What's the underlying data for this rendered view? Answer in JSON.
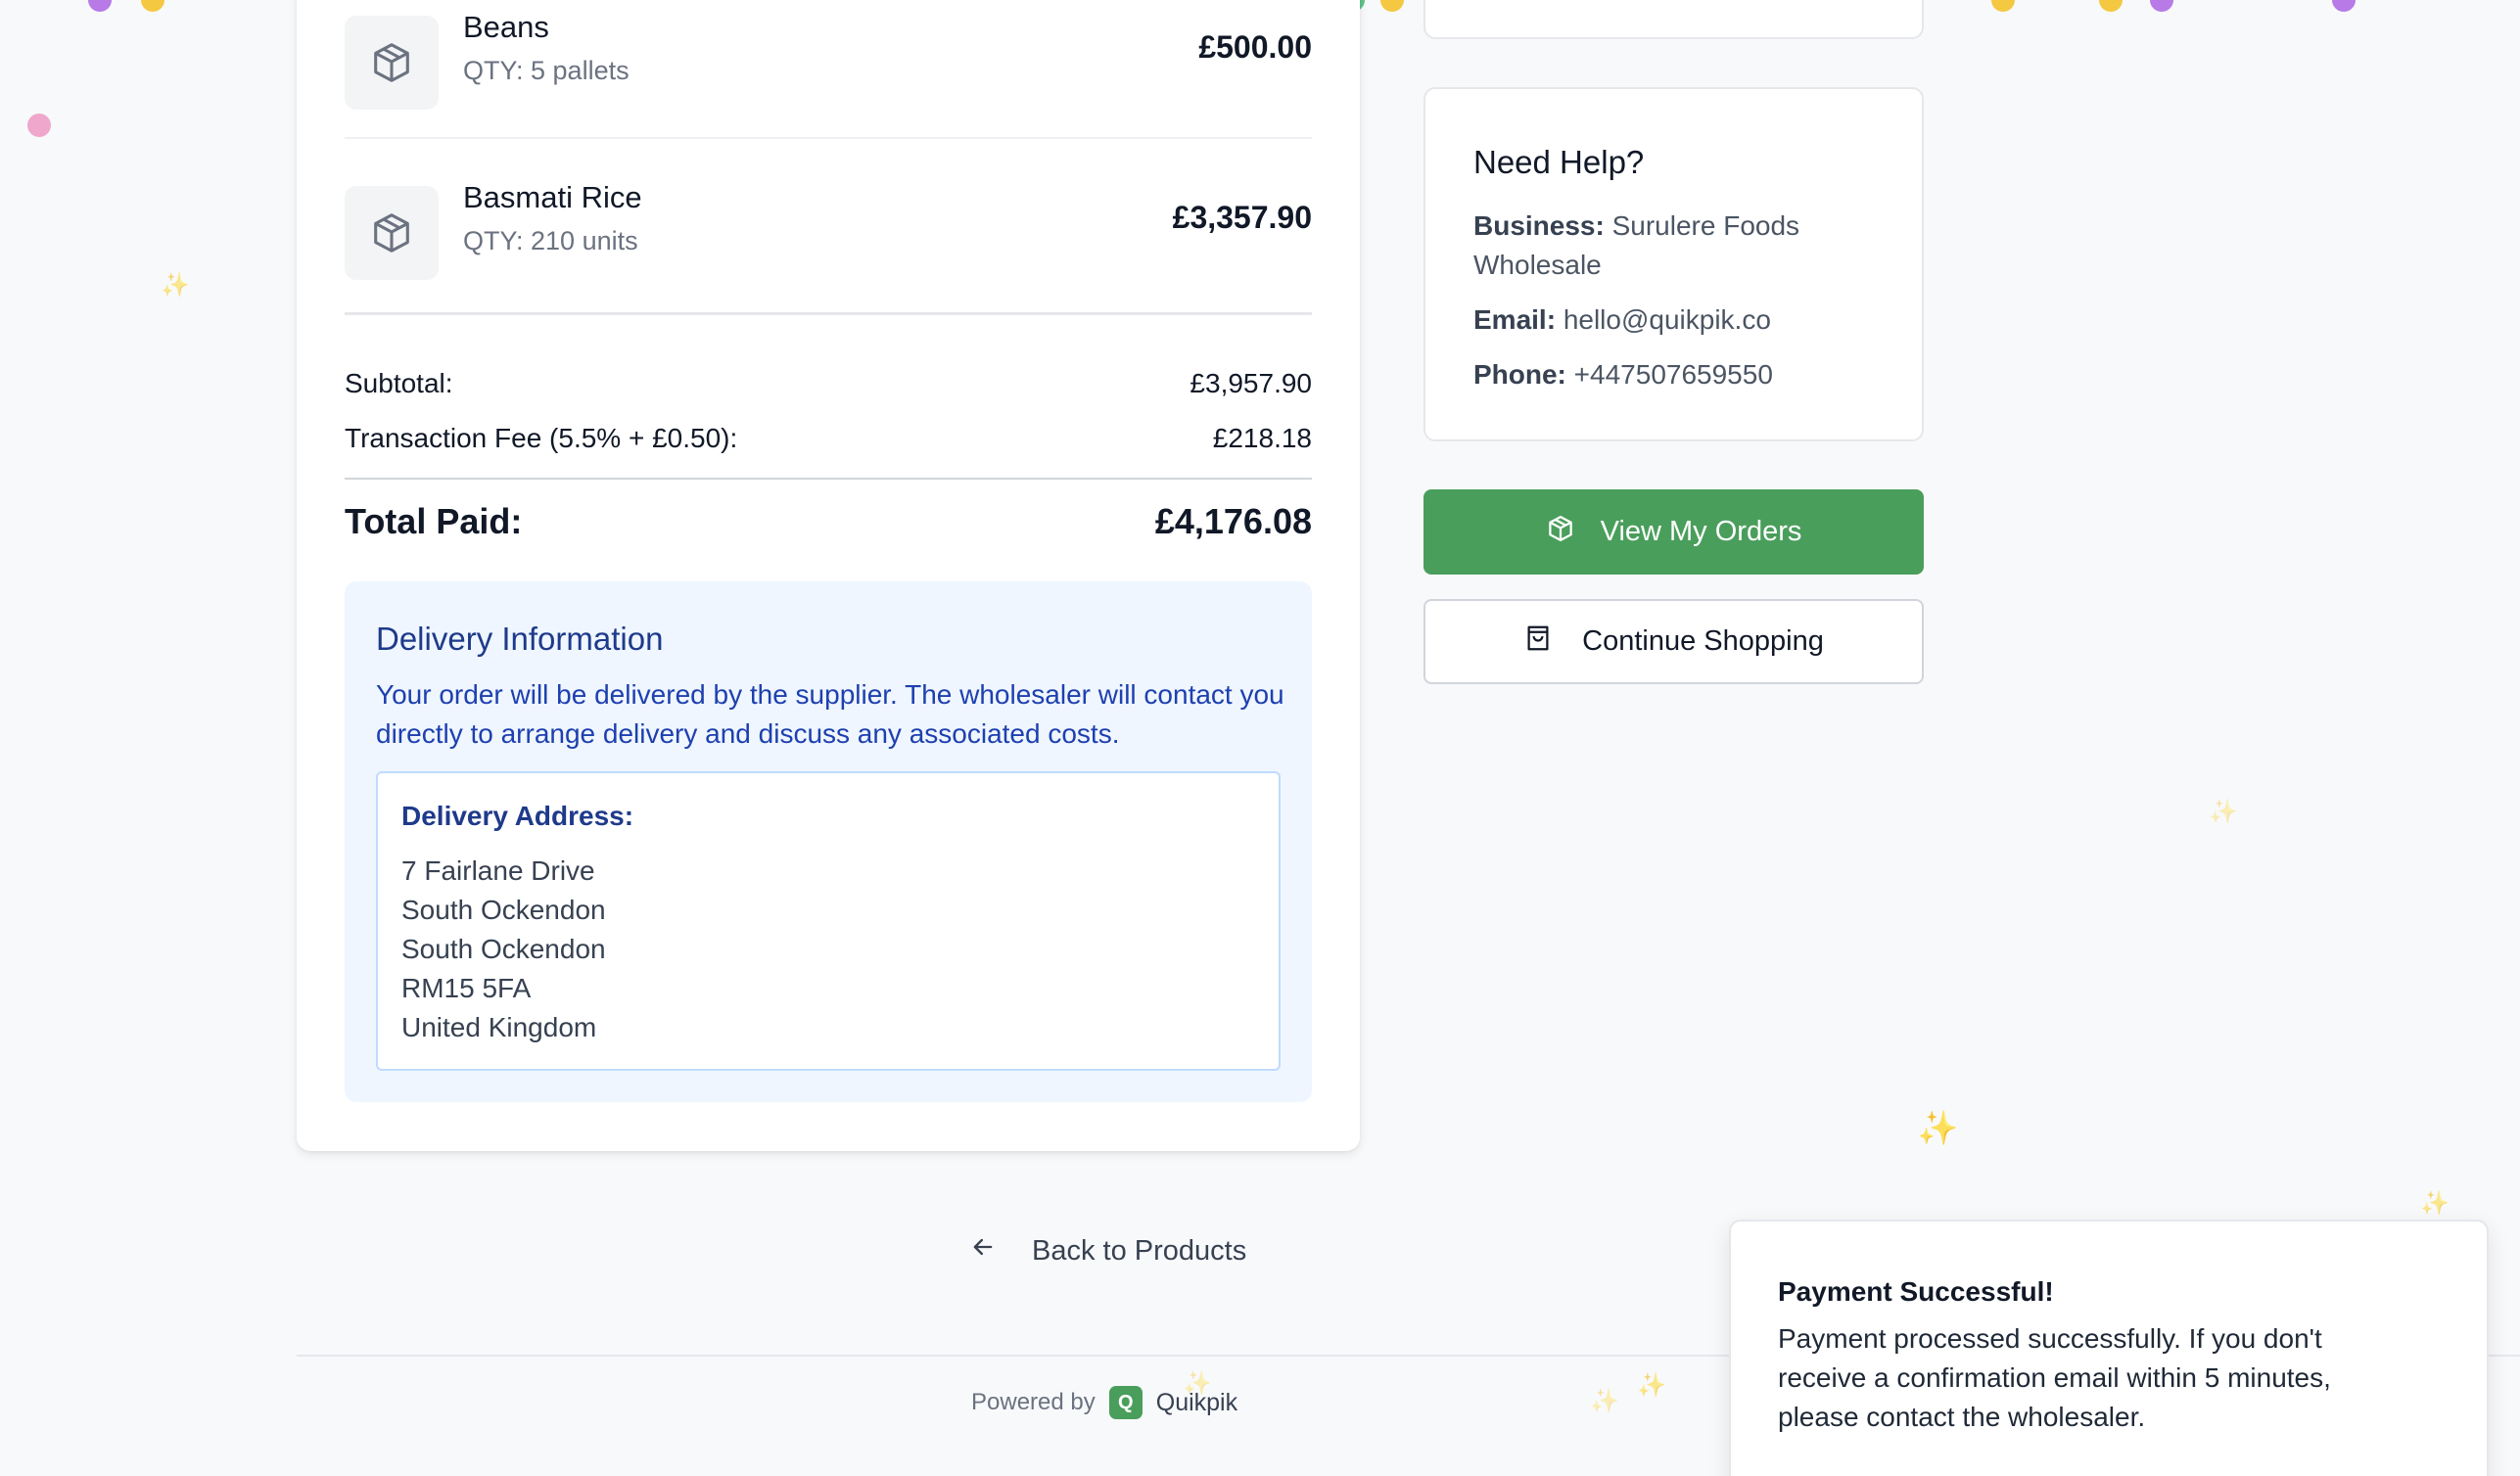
{
  "order": {
    "items": [
      {
        "name": "Beans",
        "qty": "QTY: 5 pallets",
        "price": "£500.00"
      },
      {
        "name": "Basmati Rice",
        "qty": "QTY: 210 units",
        "price": "£3,357.90"
      }
    ],
    "subtotal_label": "Subtotal:",
    "subtotal_value": "£3,957.90",
    "fee_label": "Transaction Fee (5.5% + £0.50):",
    "fee_value": "£218.18",
    "total_label": "Total Paid:",
    "total_value": "£4,176.08"
  },
  "delivery": {
    "title": "Delivery Information",
    "description": "Your order will be delivered by the supplier. The wholesaler will contact you directly to arrange delivery and discuss any associated costs.",
    "address_label": "Delivery Address:",
    "address_lines": [
      "7 Fairlane Drive",
      "South Ockendon",
      "South Ockendon",
      "RM15 5FA",
      "United Kingdom"
    ]
  },
  "help": {
    "title": "Need Help?",
    "business_label": "Business:",
    "business_value": "Surulere Foods Wholesale",
    "email_label": "Email:",
    "email_value": "hello@quikpik.co",
    "phone_label": "Phone:",
    "phone_value": "+447507659550"
  },
  "actions": {
    "view_orders": "View My Orders",
    "continue_shopping": "Continue Shopping",
    "back_to_products": "Back to Products"
  },
  "footer": {
    "powered_by": "Powered by",
    "logo_letter": "Q",
    "brand": "Quikpik"
  },
  "toast": {
    "title": "Payment Successful!",
    "message": "Payment processed successfully. If you don't receive a confirmation email within 5 minutes, please contact the wholesaler."
  },
  "colors": {
    "primary": "#4a9e5c",
    "info_bg": "#eff6ff",
    "info_text": "#1e3a8a"
  }
}
